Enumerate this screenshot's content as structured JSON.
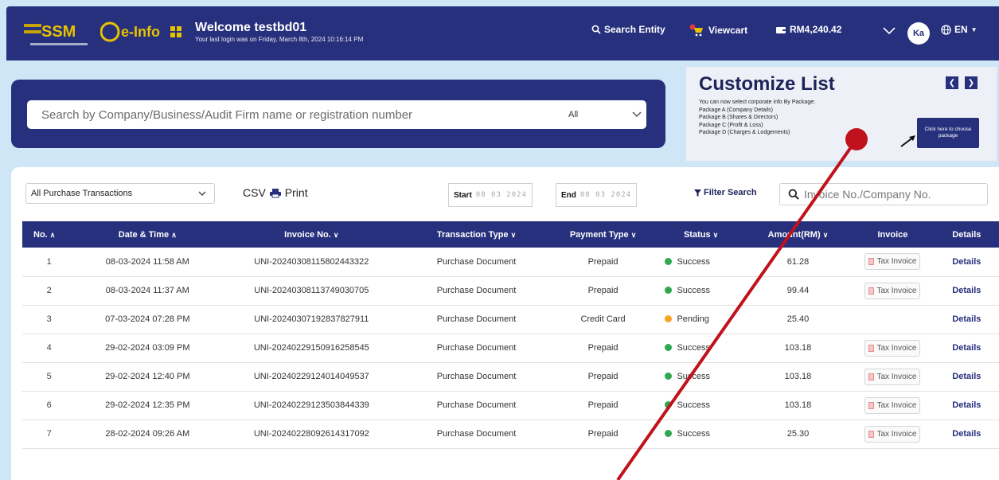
{
  "colors": {
    "brand": "#27307d",
    "success": "#2fa84f",
    "pending": "#f5a623",
    "annotation": "#c0121c"
  },
  "header": {
    "logo_ssm_text": "SSM",
    "logo_einfo_text": "e-Info",
    "welcome_title": "Welcome testbd01",
    "welcome_sub": "Your last login was on Friday, March 8th, 2024 10:16:14 PM",
    "search_entity": "Search Entity",
    "viewcart": "Viewcart",
    "balance": "RM4,240.42",
    "avatar": "Ka",
    "lang": "EN"
  },
  "search": {
    "placeholder": "Search by Company/Business/Audit Firm name or registration number",
    "category": "All"
  },
  "customize": {
    "title": "Customize List",
    "lines": [
      "You can now select corporate info By Package:",
      "Package A (Company Details)",
      "Package B (Shares & Directors)",
      "Package C (Profit & Loss)",
      "Package D (Charges & Lodgements)"
    ],
    "button": "Click here to choose package"
  },
  "filters": {
    "transaction_filter": "All Purchase Transactions",
    "csv": "CSV",
    "print": "Print",
    "start_label": "Start",
    "start_date": "08 03 2024",
    "end_label": "End",
    "end_date": "08 03 2024",
    "filter_search": "Filter Search",
    "invoice_placeholder": "Invoice No./Company No."
  },
  "table": {
    "headers": [
      "No.",
      "Date & Time",
      "Invoice No.",
      "Transaction Type",
      "Payment Type",
      "Status",
      "Amount(RM)",
      "Invoice",
      "Details"
    ],
    "tax_label": "Tax Invoice",
    "details_label": "Details",
    "rows": [
      {
        "no": "1",
        "datetime": "08-03-2024 11:58 AM",
        "invoice": "UNI-20240308115802443322",
        "type": "Purchase Document",
        "payment": "Prepaid",
        "status": "Success",
        "status_color": "#2fa84f",
        "amount": "61.28",
        "tax": true
      },
      {
        "no": "2",
        "datetime": "08-03-2024 11:37 AM",
        "invoice": "UNI-20240308113749030705",
        "type": "Purchase Document",
        "payment": "Prepaid",
        "status": "Success",
        "status_color": "#2fa84f",
        "amount": "99.44",
        "tax": true
      },
      {
        "no": "3",
        "datetime": "07-03-2024 07:28 PM",
        "invoice": "UNI-20240307192837827911",
        "type": "Purchase Document",
        "payment": "Credit Card",
        "status": "Pending",
        "status_color": "#f5a623",
        "amount": "25.40",
        "tax": false
      },
      {
        "no": "4",
        "datetime": "29-02-2024 03:09 PM",
        "invoice": "UNI-20240229150916258545",
        "type": "Purchase Document",
        "payment": "Prepaid",
        "status": "Success",
        "status_color": "#2fa84f",
        "amount": "103.18",
        "tax": true
      },
      {
        "no": "5",
        "datetime": "29-02-2024 12:40 PM",
        "invoice": "UNI-20240229124014049537",
        "type": "Purchase Document",
        "payment": "Prepaid",
        "status": "Success",
        "status_color": "#2fa84f",
        "amount": "103.18",
        "tax": true
      },
      {
        "no": "6",
        "datetime": "29-02-2024 12:35 PM",
        "invoice": "UNI-20240229123503844339",
        "type": "Purchase Document",
        "payment": "Prepaid",
        "status": "Success",
        "status_color": "#2fa84f",
        "amount": "103.18",
        "tax": true
      },
      {
        "no": "7",
        "datetime": "28-02-2024 09:26 AM",
        "invoice": "UNI-20240228092614317092",
        "type": "Purchase Document",
        "payment": "Prepaid",
        "status": "Success",
        "status_color": "#2fa84f",
        "amount": "25.30",
        "tax": true
      }
    ]
  }
}
